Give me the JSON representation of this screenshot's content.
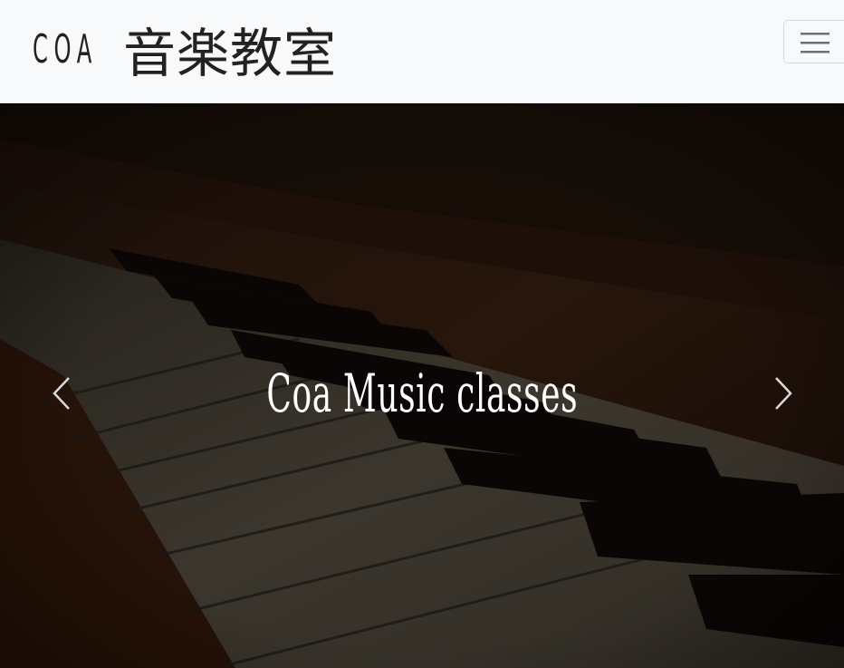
{
  "navbar": {
    "brand_latin": "COA",
    "brand_japanese": "音楽教室",
    "menu_toggle_icon": "hamburger-icon"
  },
  "carousel": {
    "slide_caption": "Coa Music classes",
    "background_image": "piano-keys-photo",
    "prev_icon": "chevron-left-icon",
    "next_icon": "chevron-right-icon"
  },
  "colors": {
    "navbar_bg": "#f8f9fa",
    "brand_text": "#222222",
    "caption_text": "#ffffff"
  }
}
